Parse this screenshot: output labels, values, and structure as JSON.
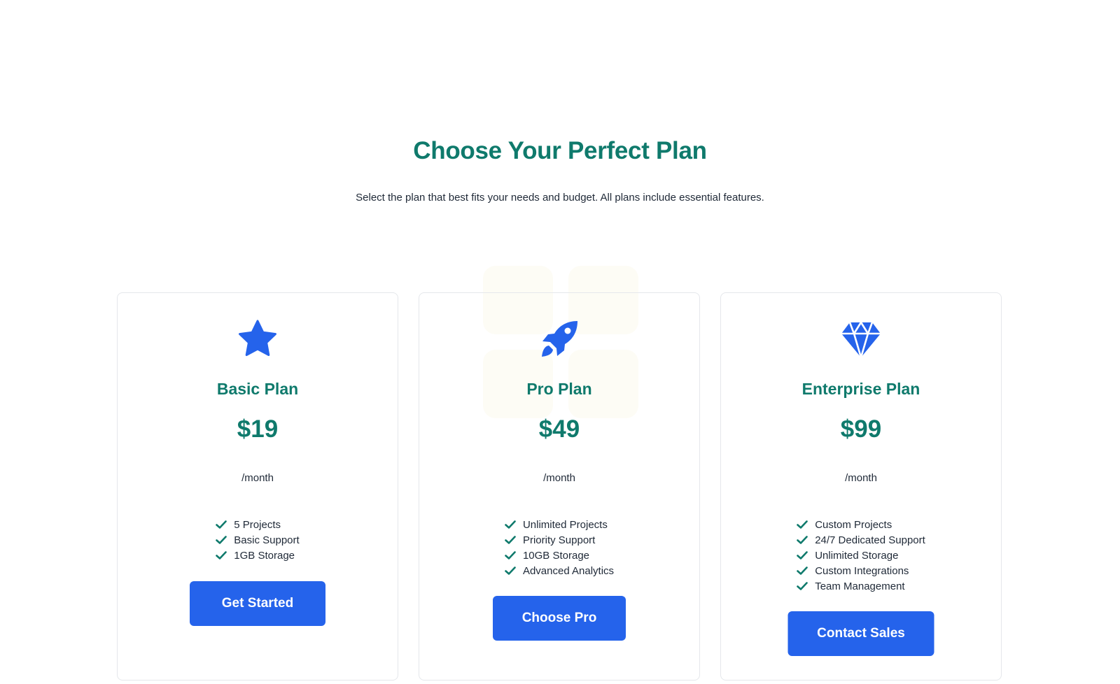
{
  "header": {
    "title": "Choose Your Perfect Plan",
    "subtitle": "Select the plan that best fits your needs and budget. All plans include essential features."
  },
  "colors": {
    "accent": "#0f7a6c",
    "button": "#2563eb",
    "icon": "#2563eb"
  },
  "plans": [
    {
      "icon": "star-icon",
      "name": "Basic Plan",
      "price": "$19",
      "period": "/month",
      "features": [
        "5 Projects",
        "Basic Support",
        "1GB Storage"
      ],
      "cta": "Get Started"
    },
    {
      "icon": "rocket-icon",
      "name": "Pro Plan",
      "price": "$49",
      "period": "/month",
      "features": [
        "Unlimited Projects",
        "Priority Support",
        "10GB Storage",
        "Advanced Analytics"
      ],
      "cta": "Choose Pro"
    },
    {
      "icon": "diamond-icon",
      "name": "Enterprise Plan",
      "price": "$99",
      "period": "/month",
      "features": [
        "Custom Projects",
        "24/7 Dedicated Support",
        "Unlimited Storage",
        "Custom Integrations",
        "Team Management"
      ],
      "cta": "Contact Sales"
    }
  ]
}
